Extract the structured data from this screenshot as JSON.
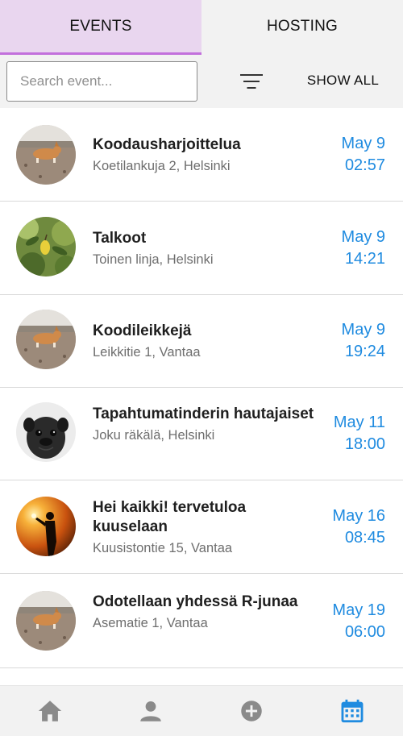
{
  "tabs": [
    {
      "label": "EVENTS",
      "active": true
    },
    {
      "label": "HOSTING",
      "active": false
    }
  ],
  "toolbar": {
    "search_placeholder": "Search event...",
    "search_value": "",
    "filter_icon": "filter-icon",
    "show_all_label": "SHOW ALL"
  },
  "events": [
    {
      "title": "Koodausharjoittelua",
      "address": "Koetilankuja 2, Helsinki",
      "date": "May 9",
      "time": "02:57",
      "avatar": "corgi-dog"
    },
    {
      "title": "Talkoot",
      "address": "Toinen linja, Helsinki",
      "date": "May 9",
      "time": "14:21",
      "avatar": "lemon-tree"
    },
    {
      "title": "Koodileikkejä",
      "address": "Leikkitie 1, Vantaa",
      "date": "May 9",
      "time": "19:24",
      "avatar": "corgi-dog"
    },
    {
      "title": "Tapahtumatinderin hautajaiset",
      "address": "Joku räkälä, Helsinki",
      "date": "May 11",
      "time": "18:00",
      "avatar": "pug-dog"
    },
    {
      "title": "Hei kaikki! tervetuloa kuuselaan",
      "address": "Kuusistontie 15, Vantaa",
      "date": "May 16",
      "time": "08:45",
      "avatar": "sunset-silhouette"
    },
    {
      "title": "Odotellaan yhdessä R-junaa",
      "address": "Asematie 1, Vantaa",
      "date": "May 19",
      "time": "06:00",
      "avatar": "corgi-dog"
    }
  ],
  "bottom_nav": [
    {
      "icon": "home-icon",
      "active": false
    },
    {
      "icon": "person-icon",
      "active": false
    },
    {
      "icon": "add-circle-icon",
      "active": false
    },
    {
      "icon": "calendar-icon",
      "active": true
    }
  ],
  "colors": {
    "accent_tab_bg": "#e9d6ef",
    "accent_tab_border": "#c270dc",
    "date_blue": "#1f8be0",
    "nav_inactive": "#8a8a8a",
    "nav_active": "#1f8be0"
  }
}
